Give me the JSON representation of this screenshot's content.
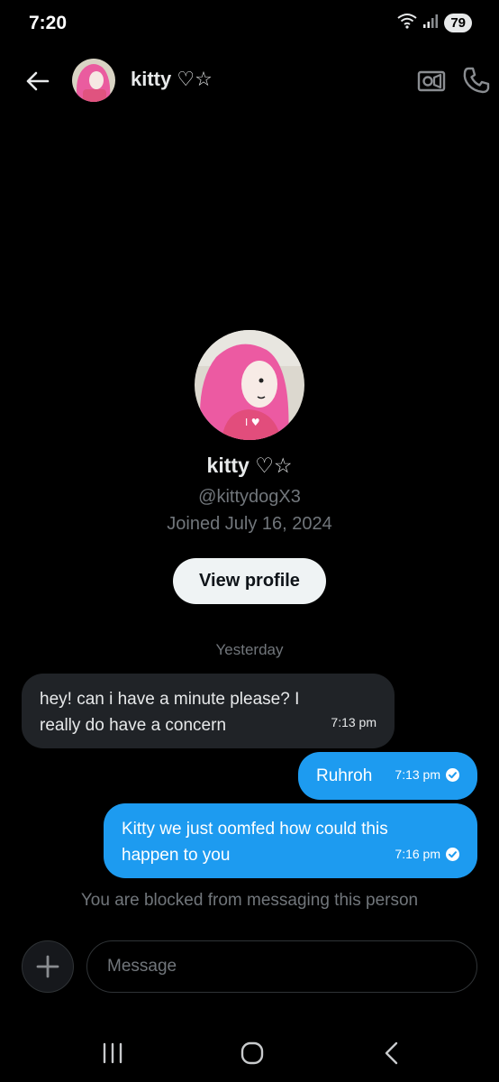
{
  "status": {
    "time": "7:20",
    "battery": "79"
  },
  "header": {
    "name": "kitty ♡☆"
  },
  "profile": {
    "name": "kitty ♡☆",
    "handle": "@kittydogX3",
    "joined": "Joined July 16, 2024",
    "view_profile_label": "View profile"
  },
  "conversation": {
    "date_separator": "Yesterday",
    "messages": [
      {
        "direction": "received",
        "text": "hey! can i have a minute please? I really do have a concern",
        "time": "7:13 pm"
      },
      {
        "direction": "sent",
        "text": "Ruhroh",
        "time": "7:13 pm"
      },
      {
        "direction": "sent",
        "text": "Kitty we just oomfed how could this happen to you",
        "time": "7:16 pm"
      }
    ],
    "blocked_notice": "You are blocked from messaging this person"
  },
  "composer": {
    "placeholder": "Message"
  },
  "colors": {
    "accent": "#1d9bf0",
    "received_bubble": "#202327",
    "background": "#000000",
    "muted_text": "#71767b"
  },
  "icons": [
    "back-arrow-icon",
    "video-camera-icon",
    "phone-icon",
    "plus-icon",
    "check-icon",
    "recents-icon",
    "home-icon",
    "nav-back-icon",
    "wifi-icon",
    "signal-icon"
  ]
}
